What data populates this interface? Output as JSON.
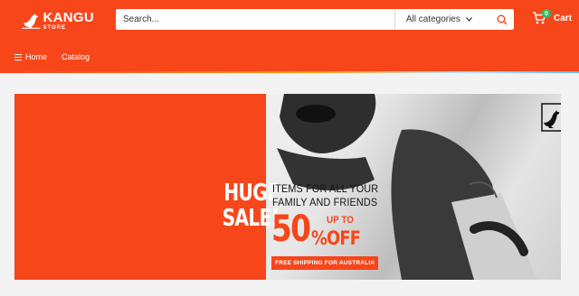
{
  "brand": {
    "name": "KANGU",
    "sub": "STORE"
  },
  "search": {
    "placeholder": "Search...",
    "category": "All categories"
  },
  "cart": {
    "count": "0",
    "label": "Cart"
  },
  "nav": {
    "items": [
      "Home",
      "Catalog"
    ]
  },
  "banner": {
    "headline_1": "HUGE",
    "headline_2": "SALE!",
    "tagline_1": "ITEMS FOR ALL YOUR",
    "tagline_2": "FAMILY AND FRIENDS",
    "percent": "50",
    "up_to": "UP TO",
    "off": "%OFF",
    "shipping": "FREE SHIPPING FOR AUSTRALIA"
  },
  "colors": {
    "brand": "#f6461a",
    "badge": "#2fbe63",
    "background": "#f3f3f3"
  },
  "icons": {
    "logo": "kangaroo-icon",
    "search": "search-icon",
    "cart": "cart-icon",
    "menu": "hamburger-icon",
    "dropdown": "chevron-down-icon"
  }
}
